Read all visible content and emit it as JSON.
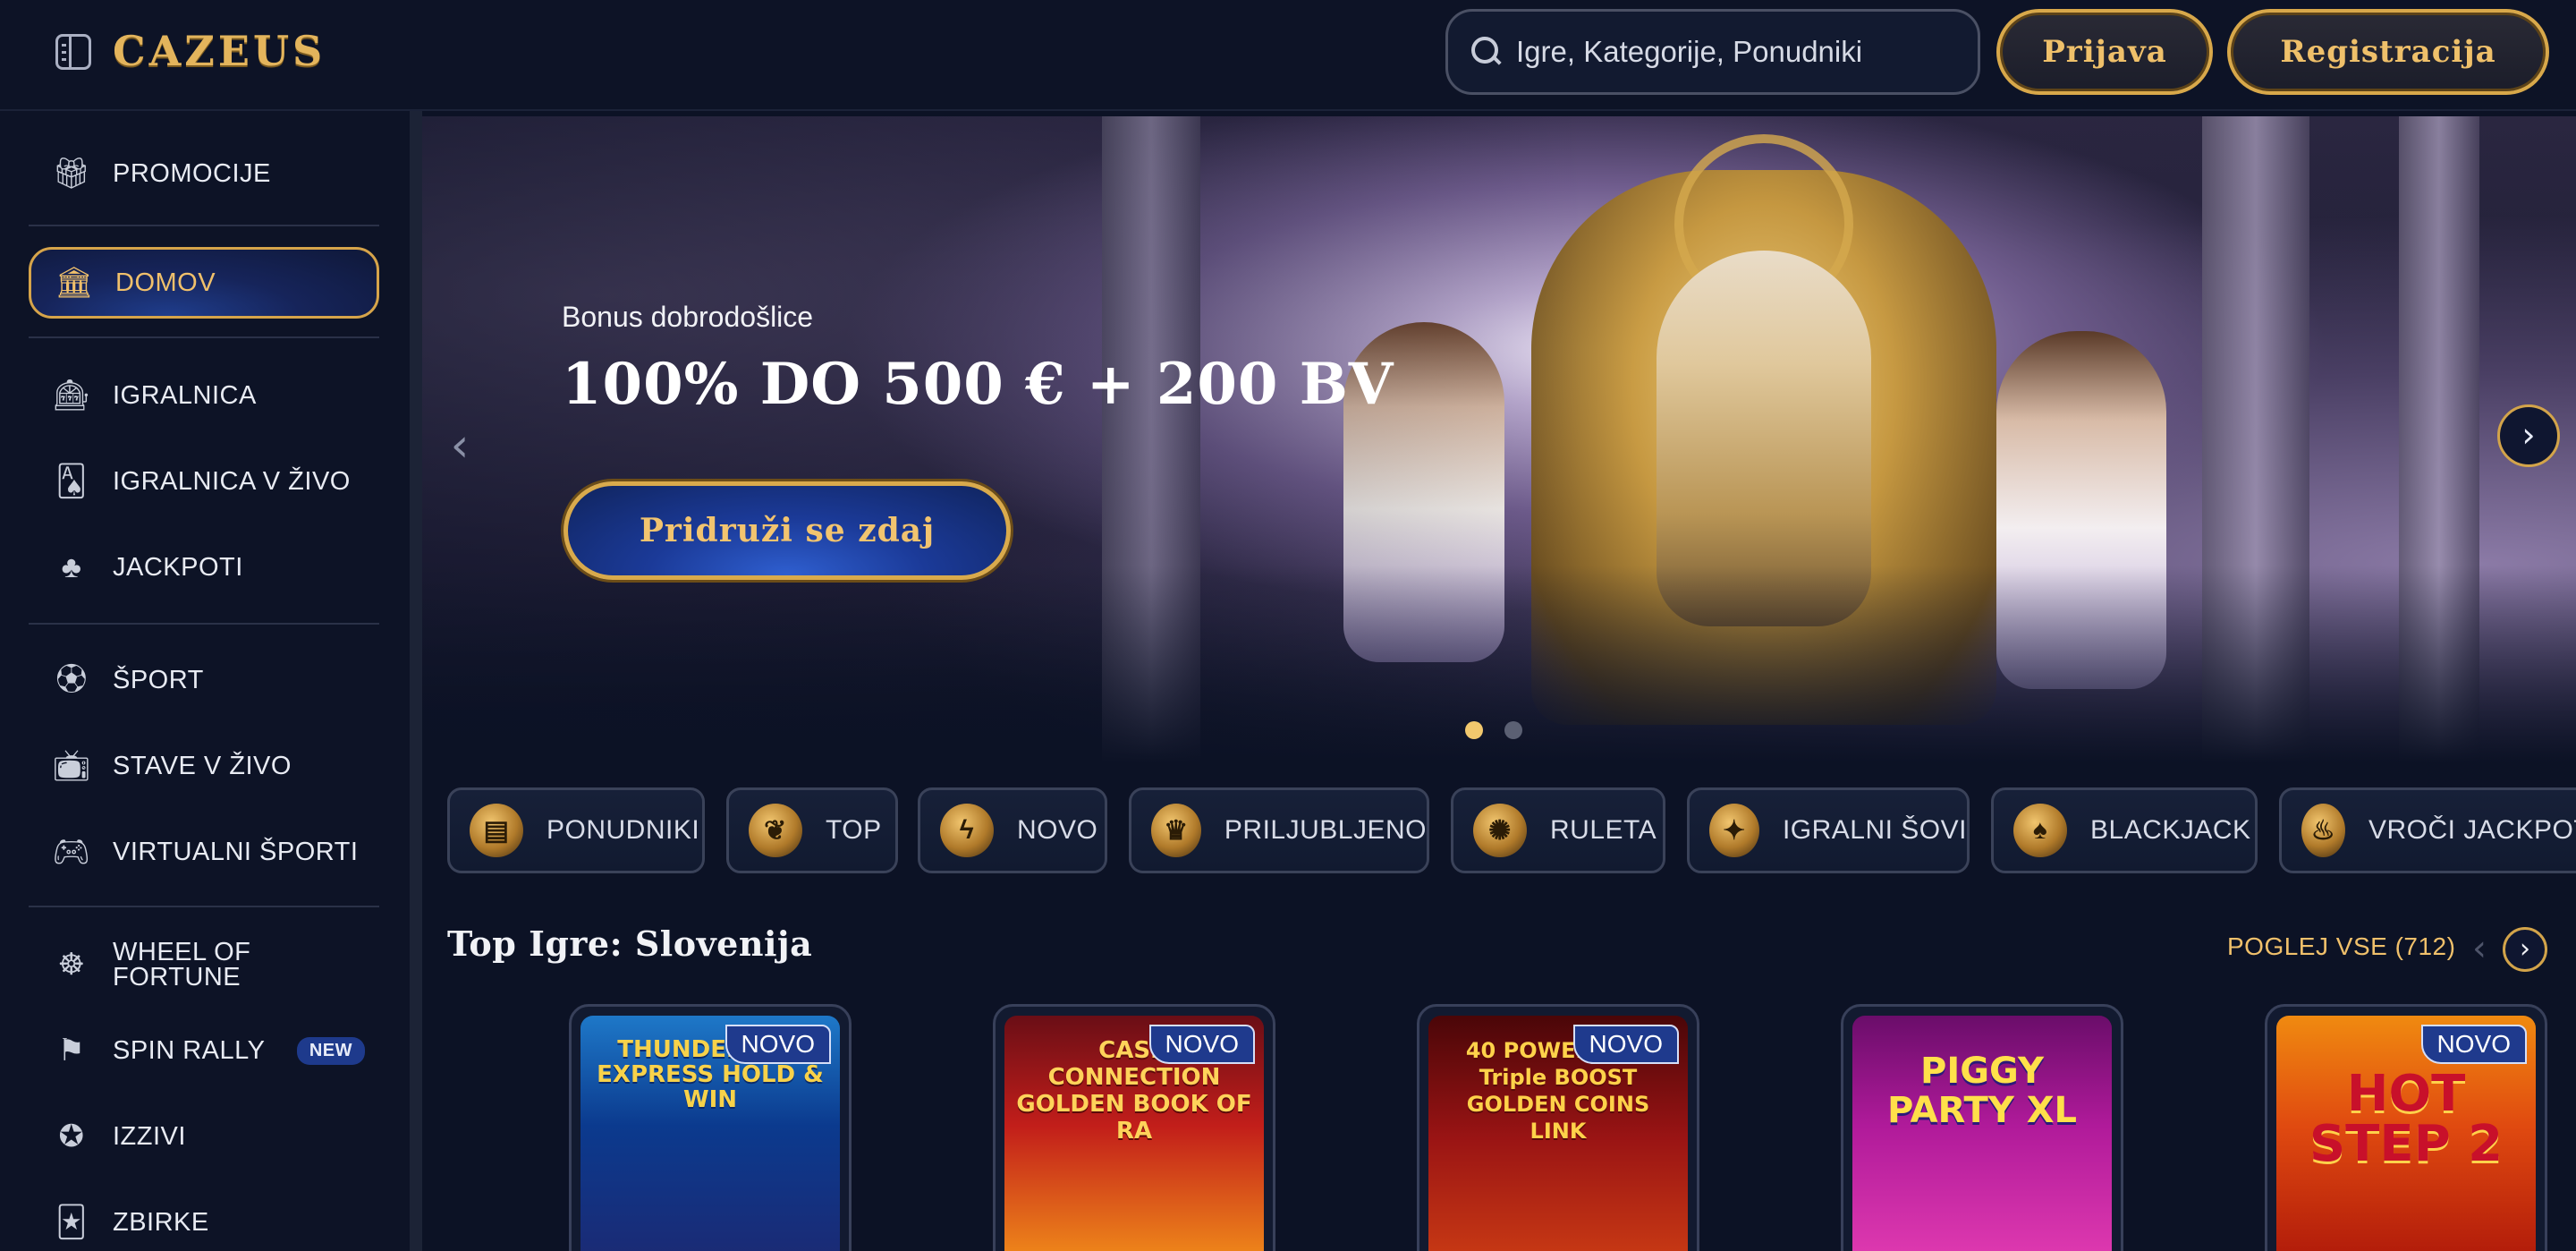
{
  "header": {
    "logo": "CAZEUS",
    "search_placeholder": "Igre, Kategorije, Ponudniki",
    "login_label": "Prijava",
    "register_label": "Registracija"
  },
  "sidebar": {
    "items": [
      {
        "label": "PROMOCIJE",
        "icon": "gift-icon"
      },
      {
        "label": "DOMOV",
        "icon": "temple-icon",
        "active": true
      },
      {
        "label": "IGRALNICA",
        "icon": "slot-machine-icon"
      },
      {
        "label": "IGRALNICA V ŽIVO",
        "icon": "live-card-icon"
      },
      {
        "label": "JACKPOTI",
        "icon": "clover-icon"
      },
      {
        "label": "ŠPORT",
        "icon": "soccer-ball-icon"
      },
      {
        "label": "STAVE V ŽIVO",
        "icon": "live-broadcast-icon"
      },
      {
        "label": "VIRTUALNI ŠPORTI",
        "icon": "gamepad-icon"
      },
      {
        "label": "WHEEL OF FORTUNE",
        "icon": "wheel-icon"
      },
      {
        "label": "SPIN RALLY",
        "icon": "race-flag-icon",
        "badge": "NEW"
      },
      {
        "label": "IZZIVI",
        "icon": "medal-icon"
      },
      {
        "label": "ZBIRKE",
        "icon": "cards-collection-icon"
      }
    ]
  },
  "hero": {
    "subtitle": "Bonus dobrodošlice",
    "title": "100% DO 500 € + 200 BV",
    "cta": "Pridruži se zdaj",
    "prev": "‹",
    "next": "›"
  },
  "categories": [
    {
      "label": "PONUDNIKI",
      "icon": "scroll-icon"
    },
    {
      "label": "TOP",
      "icon": "laurel-icon"
    },
    {
      "label": "NOVO",
      "icon": "lightning-icon"
    },
    {
      "label": "PRILJUBLJENO",
      "icon": "crown-icon"
    },
    {
      "label": "RULETA",
      "icon": "roulette-icon"
    },
    {
      "label": "IGRALNI ŠOVI",
      "icon": "show-icon"
    },
    {
      "label": "BLACKJACK",
      "icon": "cards-icon"
    },
    {
      "label": "VROČI JACKPOTI",
      "icon": "flame-icon"
    }
  ],
  "top_games": {
    "title": "Top Igre: Slovenija",
    "see_all": "POGLEJ VSE (712)",
    "games": [
      {
        "title": "THUNDERLINE EXPRESS HOLD & WIN",
        "badge": "NOVO"
      },
      {
        "title": "CASH CONNECTION GOLDEN BOOK OF RA",
        "badge": "NOVO"
      },
      {
        "title": "40 POWER HOT Triple BOOST GOLDEN COINS LINK",
        "badge": "NOVO"
      },
      {
        "title": "PIGGY PARTY XL",
        "badge": ""
      },
      {
        "title": "HOT STEP 2",
        "badge": "NOVO"
      }
    ]
  },
  "colors": {
    "background": "#0c1225",
    "gold_accent": "#f0c06b",
    "active_blue": "#1f3d8c",
    "badge_blue": "#1f3a8d"
  }
}
